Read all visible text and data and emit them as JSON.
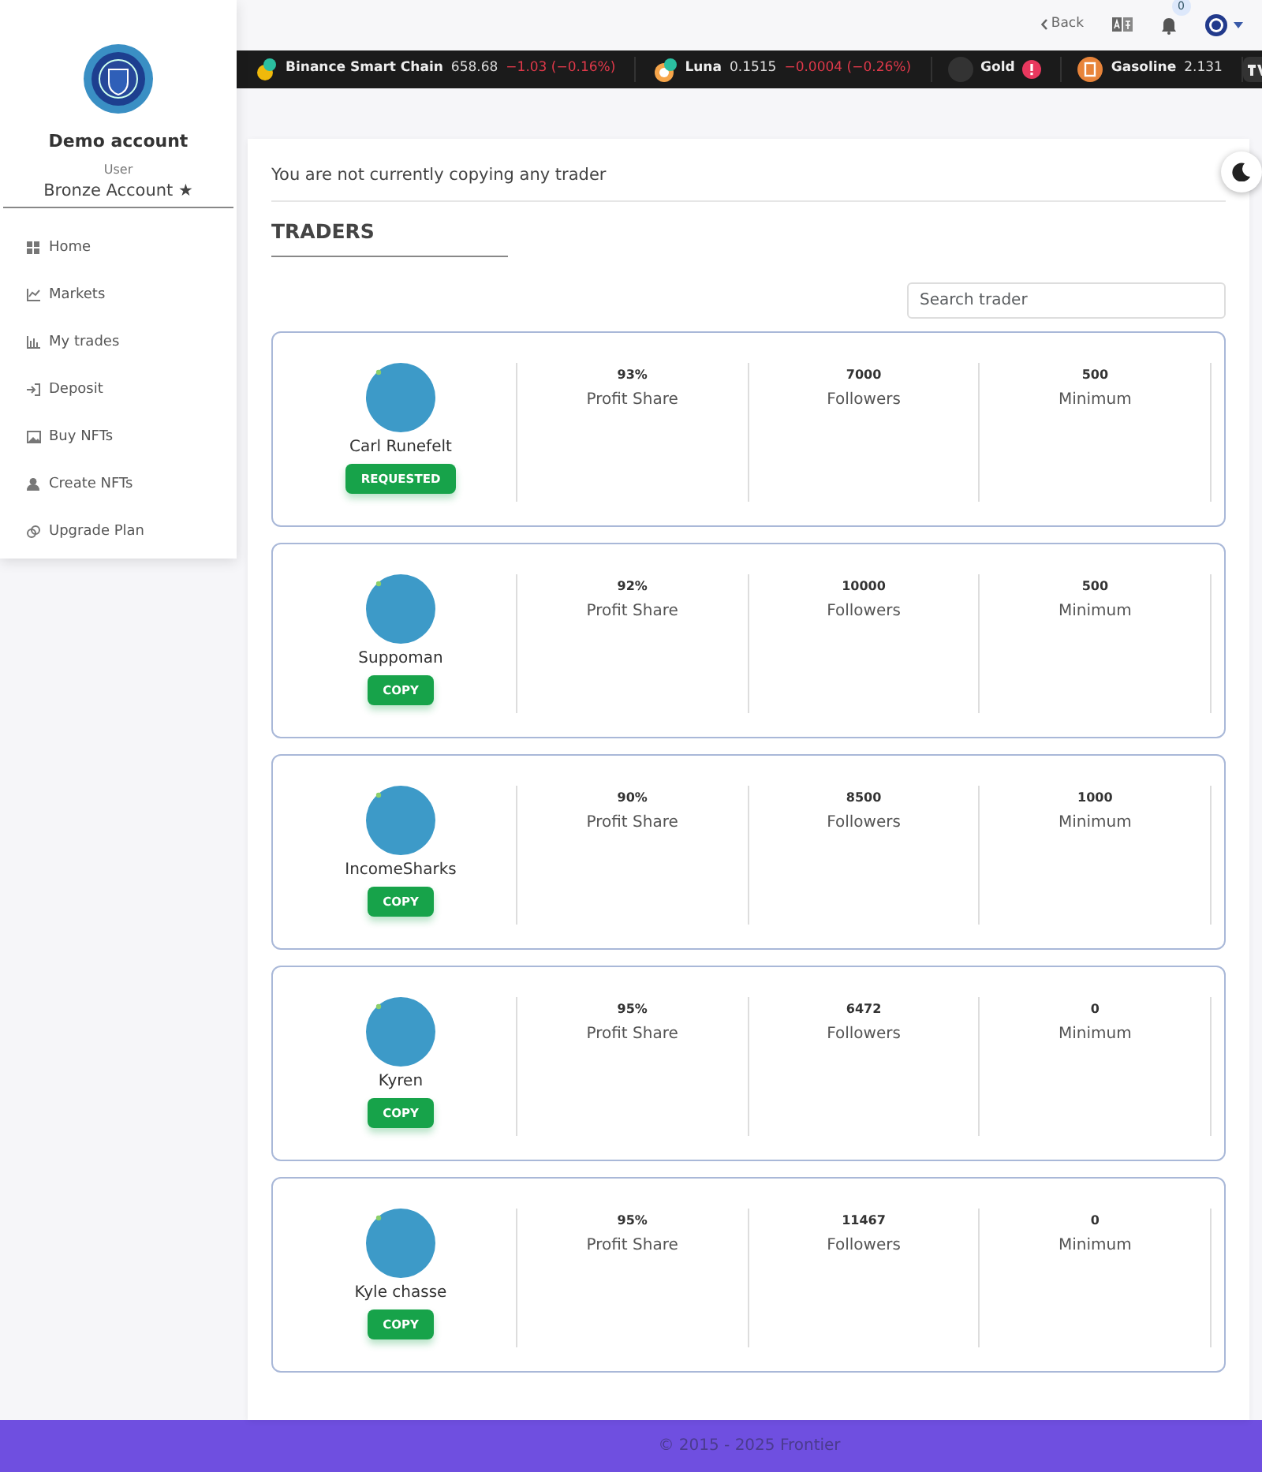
{
  "sidebar": {
    "account_name": "Demo account",
    "role": "User",
    "plan": "Bronze Account ★",
    "items": [
      {
        "label": "Home"
      },
      {
        "label": "Markets"
      },
      {
        "label": "My trades"
      },
      {
        "label": "Deposit"
      },
      {
        "label": "Buy NFTs"
      },
      {
        "label": "Create NFTs"
      },
      {
        "label": "Upgrade Plan"
      }
    ]
  },
  "header": {
    "back": "Back",
    "notifications": "0"
  },
  "ticker": [
    {
      "name": "Binance Smart Chain",
      "price": "658.68",
      "change": "−1.03 (−0.16%)",
      "alert": false
    },
    {
      "name": "Luna",
      "price": "0.1515",
      "change": "−0.0004 (−0.26%)",
      "alert": false
    },
    {
      "name": "Gold",
      "alert": true
    },
    {
      "name": "Gasoline",
      "price": "2.131",
      "alert": false
    }
  ],
  "status_message": "You are not currently copying any trader",
  "section_title": "TRADERS",
  "search": {
    "placeholder": "Search trader"
  },
  "traders": [
    {
      "name": "Carl Runefelt",
      "action": "REQUESTED",
      "stats": [
        {
          "value": "93%",
          "label": "Profit Share"
        },
        {
          "value": "7000",
          "label": "Followers"
        },
        {
          "value": "500",
          "label": "Minimum"
        }
      ]
    },
    {
      "name": "Suppoman",
      "action": "COPY",
      "stats": [
        {
          "value": "92%",
          "label": "Profit Share"
        },
        {
          "value": "10000",
          "label": "Followers"
        },
        {
          "value": "500",
          "label": "Minimum"
        }
      ]
    },
    {
      "name": "IncomeSharks",
      "action": "COPY",
      "stats": [
        {
          "value": "90%",
          "label": "Profit Share"
        },
        {
          "value": "8500",
          "label": "Followers"
        },
        {
          "value": "1000",
          "label": "Minimum"
        }
      ]
    },
    {
      "name": "Kyren",
      "action": "COPY",
      "stats": [
        {
          "value": "95%",
          "label": "Profit Share"
        },
        {
          "value": "6472",
          "label": "Followers"
        },
        {
          "value": "0",
          "label": "Minimum"
        }
      ]
    },
    {
      "name": "Kyle chasse",
      "action": "COPY",
      "stats": [
        {
          "value": "95%",
          "label": "Profit Share"
        },
        {
          "value": "11467",
          "label": "Followers"
        },
        {
          "value": "0",
          "label": "Minimum"
        }
      ]
    }
  ],
  "footer": "© 2015 - 2025 Frontier"
}
